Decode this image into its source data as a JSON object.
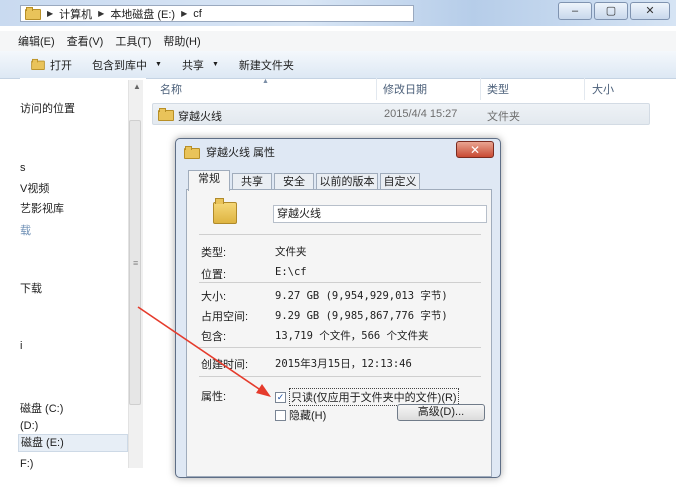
{
  "address": {
    "crumbs": [
      "计算机",
      "本地磁盘 (E:)",
      "cf"
    ]
  },
  "menu": [
    "编辑(E)",
    "查看(V)",
    "工具(T)",
    "帮助(H)"
  ],
  "toolbar": {
    "open": "打开",
    "include": "包含到库中",
    "share": "共享",
    "new_folder": "新建文件夹"
  },
  "nav_items": [
    "访问的位置",
    "s",
    "V视频",
    "艺影视库",
    "载",
    "下载",
    "i",
    "磁盘 (C:)",
    "(D:)",
    "磁盘 (E:)",
    "F:)"
  ],
  "columns": {
    "name": "名称",
    "modified": "修改日期",
    "type": "类型",
    "size": "大小"
  },
  "file_row": {
    "name": "穿越火线",
    "modified": "2015/4/4 15:27",
    "type": "文件夹"
  },
  "dialog": {
    "title": "穿越火线 属性",
    "close": "✕",
    "tabs": [
      "常规",
      "共享",
      "安全",
      "以前的版本",
      "自定义"
    ],
    "name": "穿越火线",
    "props": [
      {
        "label": "类型:",
        "value": "文件夹"
      },
      {
        "label": "位置:",
        "value": "E:\\cf"
      },
      {
        "label": "大小:",
        "value": "9.27 GB (9,954,929,013 字节)"
      },
      {
        "label": "占用空间:",
        "value": "9.29 GB (9,985,867,776 字节)"
      },
      {
        "label": "包含:",
        "value": "13,719 个文件，566 个文件夹"
      }
    ],
    "created_label": "创建时间:",
    "created_value": "2015年3月15日，12:13:46",
    "attr_label": "属性:",
    "readonly": "只读(仅应用于文件夹中的文件)(R)",
    "readonly_checked": true,
    "hidden": "隐藏(H)",
    "hidden_checked": false,
    "advanced": "高级(D)..."
  },
  "colors": {
    "arrow": "#e53b2c",
    "selection": "#e3e9ef"
  }
}
